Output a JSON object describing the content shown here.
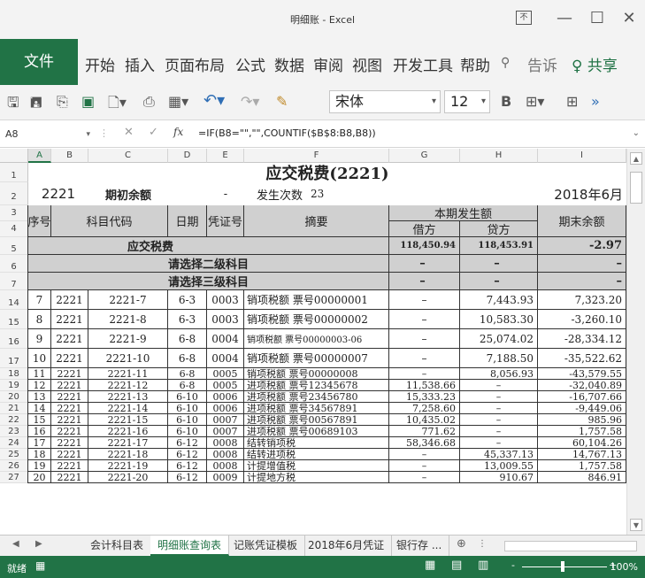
{
  "window": {
    "title": "明细账 - Excel",
    "restore_label": "不",
    "min_icon": "—",
    "max_icon": "☐",
    "close_icon": "✕"
  },
  "ribbon": {
    "tabs": [
      "文件",
      "开始",
      "插入",
      "页面布局",
      "公式",
      "数据",
      "审阅",
      "视图",
      "开发工具",
      "帮助"
    ],
    "tell_me": "告诉",
    "share": "共享"
  },
  "toolbar": {
    "font_name": "宋体",
    "font_size": "12",
    "bold_label": "B",
    "more": "»"
  },
  "formula_bar": {
    "name_box": "A8",
    "formula": "=IF(B8=\"\",\"\",COUNTIF($B$8:B8,B8))"
  },
  "columns": [
    "A",
    "B",
    "C",
    "D",
    "E",
    "F",
    "G",
    "H",
    "I"
  ],
  "sheet": {
    "title": "应交税费(2221)",
    "account_code": "2221",
    "opening_balance_label": "期初余额",
    "opening_balance_value": "-",
    "occurrences_label": "发生次数",
    "occurrences_value": "23",
    "period": "2018年6月",
    "headers": {
      "seq": "序号",
      "subject_code": "科目代码",
      "date": "日期",
      "voucher": "凭证号",
      "summary": "摘要",
      "period_amount": "本期发生额",
      "debit": "借方",
      "credit": "贷方",
      "ending_balance": "期末余额"
    },
    "summary_rows": [
      {
        "row": "5",
        "label": "应交税费",
        "debit": "118,450.94",
        "credit": "118,453.91",
        "balance": "-2.97"
      },
      {
        "row": "6",
        "label": "请选择二级科目",
        "debit": "–",
        "credit": "–",
        "balance": "–"
      },
      {
        "row": "7",
        "label": "请选择三级科目",
        "debit": "–",
        "credit": "–",
        "balance": "–"
      }
    ],
    "rows": [
      {
        "row": "14",
        "seq": "7",
        "code": "2221",
        "sub": "2221-7",
        "date": "6-3",
        "voucher": "0003",
        "summary": "销项税额 票号00000001",
        "debit": "–",
        "credit": "7,443.93",
        "balance": "7,323.20"
      },
      {
        "row": "15",
        "seq": "8",
        "code": "2221",
        "sub": "2221-8",
        "date": "6-3",
        "voucher": "0003",
        "summary": "销项税额 票号00000002",
        "debit": "–",
        "credit": "10,583.30",
        "balance": "-3,260.10"
      },
      {
        "row": "16",
        "seq": "9",
        "code": "2221",
        "sub": "2221-9",
        "date": "6-8",
        "voucher": "0004",
        "summary": "销项税额 票号00000003-06",
        "debit": "–",
        "credit": "25,074.02",
        "balance": "-28,334.12"
      },
      {
        "row": "17",
        "seq": "10",
        "code": "2221",
        "sub": "2221-10",
        "date": "6-8",
        "voucher": "0004",
        "summary": "销项税额 票号00000007",
        "debit": "–",
        "credit": "7,188.50",
        "balance": "-35,522.62"
      },
      {
        "row": "18",
        "seq": "11",
        "code": "2221",
        "sub": "2221-11",
        "date": "6-8",
        "voucher": "0005",
        "summary": "销项税额 票号00000008",
        "debit": "–",
        "credit": "8,056.93",
        "balance": "-43,579.55"
      },
      {
        "row": "19",
        "seq": "12",
        "code": "2221",
        "sub": "2221-12",
        "date": "6-8",
        "voucher": "0005",
        "summary": "进项税额 票号12345678",
        "debit": "11,538.66",
        "credit": "–",
        "balance": "-32,040.89"
      },
      {
        "row": "20",
        "seq": "13",
        "code": "2221",
        "sub": "2221-13",
        "date": "6-10",
        "voucher": "0006",
        "summary": "进项税额 票号23456780",
        "debit": "15,333.23",
        "credit": "–",
        "balance": "-16,707.66"
      },
      {
        "row": "21",
        "seq": "14",
        "code": "2221",
        "sub": "2221-14",
        "date": "6-10",
        "voucher": "0006",
        "summary": "进项税额 票号34567891",
        "debit": "7,258.60",
        "credit": "–",
        "balance": "-9,449.06"
      },
      {
        "row": "22",
        "seq": "15",
        "code": "2221",
        "sub": "2221-15",
        "date": "6-10",
        "voucher": "0007",
        "summary": "进项税额 票号00567891",
        "debit": "10,435.02",
        "credit": "–",
        "balance": "985.96"
      },
      {
        "row": "23",
        "seq": "16",
        "code": "2221",
        "sub": "2221-16",
        "date": "6-10",
        "voucher": "0007",
        "summary": "进项税额 票号00689103",
        "debit": "771.62",
        "credit": "–",
        "balance": "1,757.58"
      },
      {
        "row": "24",
        "seq": "17",
        "code": "2221",
        "sub": "2221-17",
        "date": "6-12",
        "voucher": "0008",
        "summary": "结转销项税",
        "debit": "58,346.68",
        "credit": "–",
        "balance": "60,104.26"
      },
      {
        "row": "25",
        "seq": "18",
        "code": "2221",
        "sub": "2221-18",
        "date": "6-12",
        "voucher": "0008",
        "summary": "结转进项税",
        "debit": "–",
        "credit": "45,337.13",
        "balance": "14,767.13"
      },
      {
        "row": "26",
        "seq": "19",
        "code": "2221",
        "sub": "2221-19",
        "date": "6-12",
        "voucher": "0008",
        "summary": "计提增值税",
        "debit": "–",
        "credit": "13,009.55",
        "balance": "1,757.58"
      },
      {
        "row": "27",
        "seq": "20",
        "code": "2221",
        "sub": "2221-20",
        "date": "6-12",
        "voucher": "0009",
        "summary": "计提地方税",
        "debit": "–",
        "credit": "910.67",
        "balance": "846.91"
      }
    ],
    "top_row_numbers": [
      "1",
      "2",
      "3",
      "4"
    ]
  },
  "sheet_tabs": [
    "会计科目表",
    "明细账查询表",
    "记账凭证模板",
    "2018年6月凭证",
    "银行存 ..."
  ],
  "active_sheet_index": 1,
  "status": {
    "ready": "就绪",
    "zoom": "100%"
  },
  "colors": {
    "excel_green": "#217346",
    "summary_gray": "#d0d0d0"
  }
}
